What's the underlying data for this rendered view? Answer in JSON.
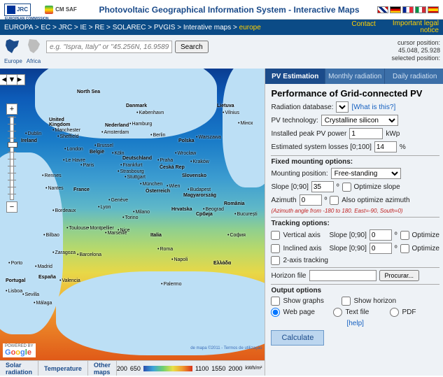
{
  "header": {
    "jrc": "JRC",
    "eu_caption": "EUROPEAN COMMISSION",
    "cmsaf": "CM SAF",
    "title": "Photovoltaic Geographical Information System - Interactive Maps"
  },
  "bar": {
    "crumbs": [
      "EUROPA",
      "EC",
      "JRC",
      "IE",
      "RE",
      "SOLAREC",
      "PVGIS",
      "Interative maps"
    ],
    "current": "europe",
    "contact": "Contact",
    "legal1": "Important legal",
    "legal2": "notice"
  },
  "continents": {
    "europe": "Europe",
    "africa": "Africa"
  },
  "search": {
    "placeholder": "e.g. \"Ispra, Italy\" or \"45.256N, 16.9589E\"",
    "button": "Search"
  },
  "cursor": {
    "l1": "cursor position:",
    "l2": "45.048, 25.928",
    "l3": "selected position:"
  },
  "tabs": {
    "t1": "PV Estimation",
    "t2": "Monthly radiation",
    "t3": "Daily radiation"
  },
  "form": {
    "heading": "Performance of Grid-connected PV",
    "db_label": "Radiation database:",
    "db_help": "[What is this?]",
    "tech_label": "PV technology:",
    "tech_value": "Crystalline silicon",
    "peak_label": "Installed peak PV power",
    "peak_value": "1",
    "peak_unit": "kWp",
    "loss_label": "Estimated system losses [0;100]",
    "loss_value": "14",
    "loss_unit": "%",
    "fixed_section": "Fixed mounting options:",
    "mount_label": "Mounting position:",
    "mount_value": "Free-standing",
    "slope_label": "Slope [0;90]",
    "slope_value": "35",
    "slope_deg": "º",
    "opt_slope": "Optimize slope",
    "az_label": "Azimuth",
    "az_value": "0",
    "az_deg": "º",
    "opt_az": "Also optimize azimuth",
    "az_note": "(Azimuth angle from -180 to 180. East=-90, South=0)",
    "track_section": "Tracking options:",
    "vert": "Vertical axis",
    "incl": "Inclined axis",
    "tslope": "Slope [0;90]",
    "tslope_v1": "0",
    "tslope_v2": "0",
    "tdeg": "º",
    "topt": "Optimize",
    "twoaxis": "2-axis tracking",
    "horizon_label": "Horizon file",
    "browse": "Procurar...",
    "output_section": "Output options",
    "out_graphs": "Show graphs",
    "out_horizon": "Show horizon",
    "out_web": "Web page",
    "out_text": "Text file",
    "out_pdf": "PDF",
    "help": "[help]",
    "calc": "Calculate"
  },
  "legend": {
    "t1": "Solar radiation",
    "t2": "Temperature",
    "t3": "Other maps",
    "v1": "200",
    "v2": "650",
    "v3": "1100",
    "v4": "1550",
    "v5": "2000",
    "unit": "kWh/m²"
  },
  "google": {
    "pow": "POWERED BY"
  },
  "mapcred": "de mapa ©2011 - Termos de utilização",
  "cities": {
    "northsea": "North Sea",
    "uk": "United\nKingdom",
    "ireland": "Ireland",
    "dublin": "Dublin",
    "manch": "Manchester",
    "sheff": "Sheffield",
    "london": "London",
    "paris": "Paris",
    "france": "France",
    "lehavre": "Le Havre",
    "rennes": "Rennes",
    "nantes": "Nantes",
    "bordeaux": "Bordeaux",
    "toulouse": "Toulouse",
    "montp": "Montpellier",
    "lyon": "Lyon",
    "geneve": "Genève",
    "bilbao": "Bilbao",
    "zaragoza": "Zaragoza",
    "madrid": "Madrid",
    "valencia": "Valencia",
    "sevilla": "Sevilla",
    "malaga": "Málaga",
    "portugal": "Portugal",
    "lisboa": "Lisboa",
    "porto": "Porto",
    "espana": "España",
    "marseille": "Marseille",
    "nice": "Nice",
    "torino": "Torino",
    "milano": "Milano",
    "italia": "Italia",
    "roma": "Roma",
    "napoli": "Napoli",
    "palermo": "Palermo",
    "nl": "Nederland",
    "amst": "Amsterdam",
    "brussel": "Brussel",
    "belg": "België",
    "de": "Deutschland",
    "hamburg": "Hamburg",
    "berlin": "Berlin",
    "koln": "Köln",
    "frank": "Frankfurt",
    "stutt": "Stuttgart",
    "munchen": "München",
    "danmark": "Danmark",
    "koben": "København",
    "polska": "Polska",
    "warsz": "Warszawa",
    "wroclaw": "Wrocław",
    "krakow": "Kraków",
    "cesko": "Česká Rep",
    "praha": "Praha",
    "osterr": "Österreich",
    "wien": "Wien",
    "slovensko": "Slovensko",
    "magyar": "Magyarország",
    "budapest": "Budapest",
    "romania": "România",
    "bucur": "București",
    "sofia": "София",
    "grecia": "Ελλάδα",
    "srbija": "Србија",
    "beograd": "Beograd",
    "hrvat": "Hrvatska",
    "lietuva": "Lietuva",
    "vilnius": "Vilnius",
    "minsk": "Мінск",
    "barc": "Barcelona",
    "strasb": "Strasbourg"
  }
}
